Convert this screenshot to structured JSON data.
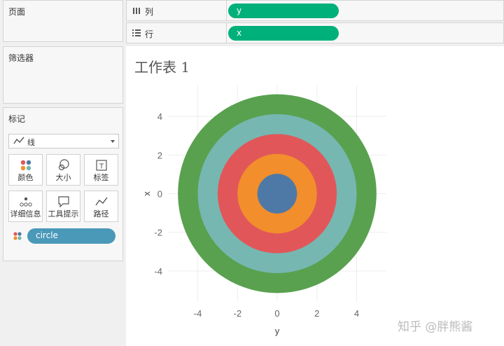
{
  "left_panel": {
    "pages_title": "页面",
    "filters_title": "筛选器",
    "marks_title": "标记",
    "mark_type": "线",
    "buttons": [
      {
        "label": "颜色",
        "icon": "color-dots-icon"
      },
      {
        "label": "大小",
        "icon": "size-circles-icon"
      },
      {
        "label": "标签",
        "icon": "label-t-icon"
      },
      {
        "label": "详细信息",
        "icon": "detail-dots-icon"
      },
      {
        "label": "工具提示",
        "icon": "tooltip-bubble-icon"
      },
      {
        "label": "路径",
        "icon": "path-line-icon"
      }
    ],
    "color_pill": "circle"
  },
  "columns_shelf": {
    "label": "列",
    "pill": "y"
  },
  "rows_shelf": {
    "label": "行",
    "pill": "x"
  },
  "sheet": {
    "title": "工作表 1"
  },
  "chart_data": {
    "type": "area",
    "description_kind": "concentric filled circles",
    "xlabel": "y",
    "ylabel": "x",
    "xlim": [
      -5.5,
      5.5
    ],
    "ylim": [
      -5.6,
      5.6
    ],
    "x_ticks": [
      "-4",
      "-2",
      "0",
      "2",
      "4"
    ],
    "y_ticks": [
      "4",
      "2",
      "0",
      "-2",
      "-4"
    ],
    "y_tick_values": [
      4,
      2,
      0,
      -2,
      -4
    ],
    "x_tick_values": [
      -4,
      -2,
      0,
      2,
      4
    ],
    "grid": true,
    "series": [
      {
        "radius": 5,
        "color": "#59a14f"
      },
      {
        "radius": 4,
        "color": "#76b7b2"
      },
      {
        "radius": 3,
        "color": "#e15759"
      },
      {
        "radius": 2,
        "color": "#f28e2b"
      },
      {
        "radius": 1,
        "color": "#4e79a7"
      }
    ]
  },
  "watermark": "知乎 @胖熊酱"
}
